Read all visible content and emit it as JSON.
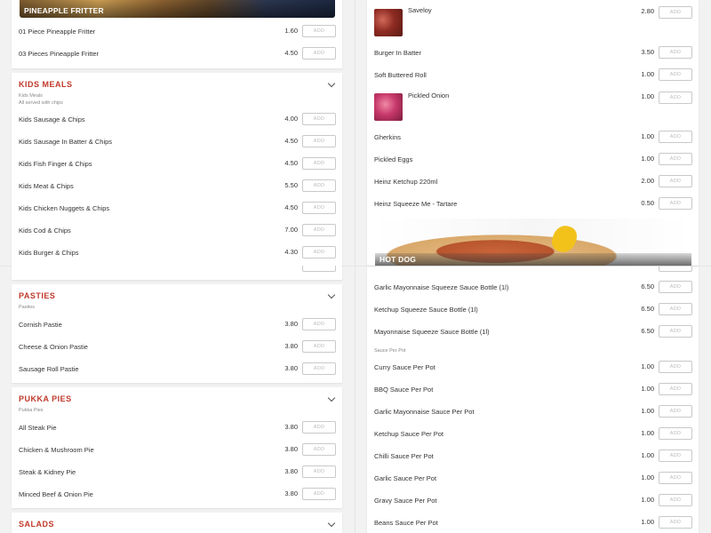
{
  "add_label": "ADD",
  "left": {
    "pineapple": {
      "banner": "PINEAPPLE FRITTER",
      "items": [
        {
          "name": "01 Piece Pineapple Fritter",
          "price": "1.60"
        },
        {
          "name": "03 Pieces Pineapple Fritter",
          "price": "4.50"
        }
      ]
    },
    "kids_meals": {
      "title": "KIDS MEALS",
      "subtitle": "Kids Meals",
      "note": "All served with chips",
      "items": [
        {
          "name": "Kids Sausage & Chips",
          "price": "4.00"
        },
        {
          "name": "Kids Sausage In Batter & Chips",
          "price": "4.50"
        },
        {
          "name": "Kids Fish Finger & Chips",
          "price": "4.50"
        },
        {
          "name": "Kids Meat & Chips",
          "price": "5.50"
        },
        {
          "name": "Kids Chicken Nuggets & Chips",
          "price": "4.50"
        },
        {
          "name": "Kids Cod & Chips",
          "price": "7.00"
        },
        {
          "name": "Kids Burger & Chips",
          "price": "4.30"
        }
      ]
    },
    "pasties": {
      "title": "PASTIES",
      "subtitle": "Pasties",
      "items": [
        {
          "name": "Cornish Pastie",
          "price": "3.80"
        },
        {
          "name": "Cheese & Onion Pastie",
          "price": "3.80"
        },
        {
          "name": "Sausage Roll Pastie",
          "price": "3.80"
        }
      ]
    },
    "pukka_pies": {
      "title": "PUKKA PIES",
      "subtitle": "Pukka Pies",
      "items": [
        {
          "name": "All Steak Pie",
          "price": "3.80"
        },
        {
          "name": "Chicken & Mushroom Pie",
          "price": "3.80"
        },
        {
          "name": "Steak & Kidney Pie",
          "price": "3.80"
        },
        {
          "name": "Minced Beef & Onion Pie",
          "price": "3.80"
        }
      ]
    },
    "salads": {
      "title": "SALADS"
    }
  },
  "right": {
    "extras": {
      "items": [
        {
          "name": "Saveloy",
          "price": "2.80",
          "thumb": "saveloy"
        },
        {
          "name": "Burger In Batter",
          "price": "3.50"
        },
        {
          "name": "Soft Buttered Roll",
          "price": "1.00"
        },
        {
          "name": "Pickled Onion",
          "price": "1.00",
          "thumb": "pickled-onion"
        },
        {
          "name": "Gherkins",
          "price": "1.00"
        },
        {
          "name": "Pickled Eggs",
          "price": "1.00"
        },
        {
          "name": "Heinz Ketchup 220ml",
          "price": "2.00"
        },
        {
          "name": "Heinz Squeeze Me - Tartare",
          "price": "0.50"
        }
      ]
    },
    "hot_dog": {
      "banner": "HOT DOG"
    },
    "sauces": {
      "bottles": [
        {
          "name": "Garlic Mayonnaise Squeeze Sauce Bottle (1l)",
          "price": "6.50"
        },
        {
          "name": "Ketchup Squeeze Sauce Bottle (1l)",
          "price": "6.50"
        },
        {
          "name": "Mayonnaise Squeeze Sauce Bottle (1l)",
          "price": "6.50"
        }
      ],
      "pot_subtitle": "Sauce Per Pot",
      "pots": [
        {
          "name": "Curry Sauce Per Pot",
          "price": "1.00"
        },
        {
          "name": "BBQ Sauce Per Pot",
          "price": "1.00"
        },
        {
          "name": "Garlic Mayonnaise Sauce Per Pot",
          "price": "1.00"
        },
        {
          "name": "Ketchup Sauce Per Pot",
          "price": "1.00"
        },
        {
          "name": "Chilli Sauce Per Pot",
          "price": "1.00"
        },
        {
          "name": "Garlic Sauce Per Pot",
          "price": "1.00"
        },
        {
          "name": "Gravy Sauce Per Pot",
          "price": "1.00"
        },
        {
          "name": "Beans Sauce Per Pot",
          "price": "1.00"
        }
      ]
    }
  },
  "colors": {
    "accent": "#c0392b",
    "background": "#f2f2f2"
  }
}
